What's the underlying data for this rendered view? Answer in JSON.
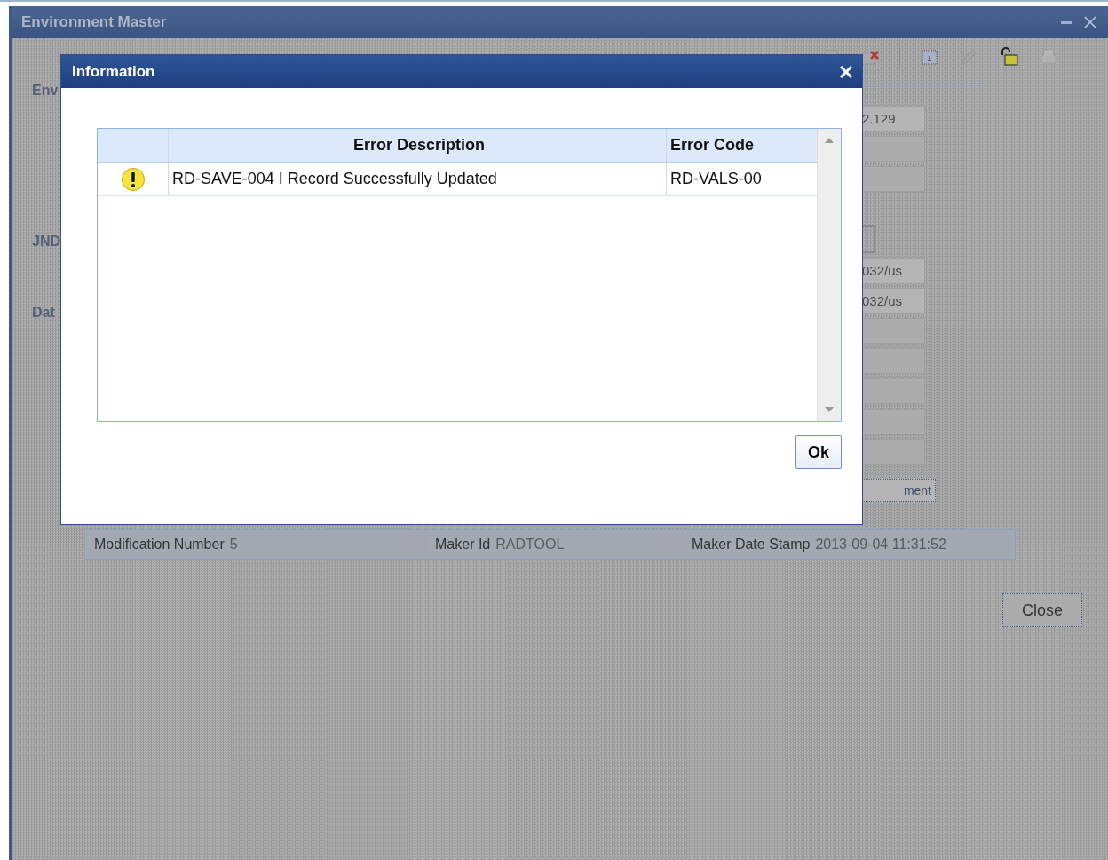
{
  "window": {
    "title": "Environment Master"
  },
  "form": {
    "sections": [
      {
        "legend": "Env"
      },
      {
        "legend": "JND"
      },
      {
        "legend": "Dat"
      }
    ],
    "top_fields": [
      {
        "kind": "text",
        "value": "2.129"
      },
      {
        "kind": "blank"
      },
      {
        "kind": "blank"
      }
    ],
    "path_fields": [
      {
        "kind": "text",
        "value": "032/us"
      },
      {
        "kind": "text",
        "value": "032/us"
      },
      {
        "kind": "blank"
      },
      {
        "kind": "blank"
      },
      {
        "kind": "blank"
      },
      {
        "kind": "blank"
      },
      {
        "kind": "blank"
      }
    ],
    "button": "ment"
  },
  "audit": [
    {
      "label": "Modification Number",
      "value": "5"
    },
    {
      "label": "Maker Id",
      "value": "RADTOOL"
    },
    {
      "label": "Maker Date Stamp",
      "value": "2013-09-04 11:31:52"
    }
  ],
  "close_button": "Close",
  "dialog": {
    "title": "Information",
    "table": {
      "columns": [
        "Error Description",
        "Error Code"
      ],
      "rows": [
        {
          "kind": "warning",
          "description": "RD-SAVE-004 I Record Successfully Updated",
          "code": "RD-VALS-00"
        }
      ]
    },
    "ok_button": "Ok"
  }
}
